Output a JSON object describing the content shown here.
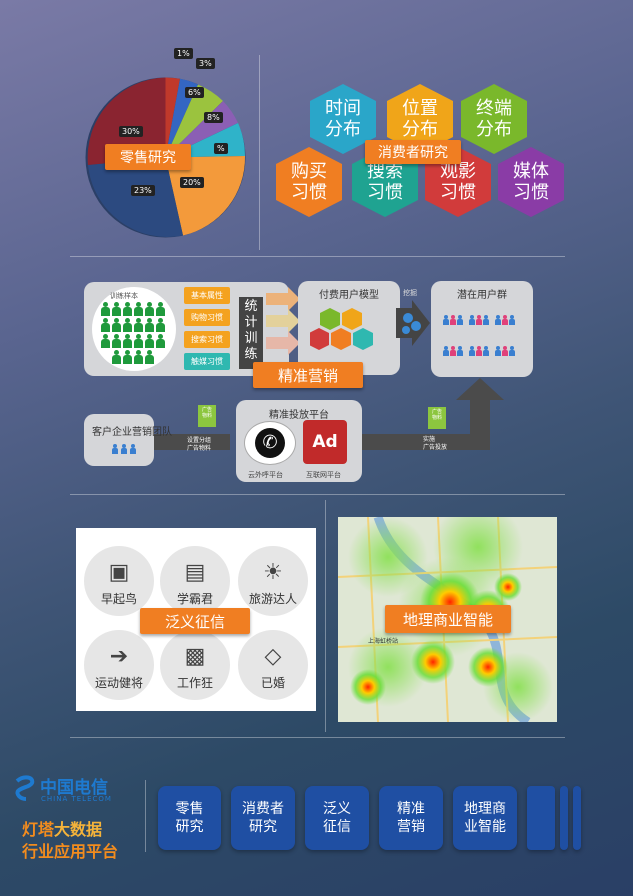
{
  "retail": {
    "label": "零售研究",
    "percents": [
      "1%",
      "3%",
      "6%",
      "8%",
      "%",
      "20%",
      "23%",
      "30%"
    ]
  },
  "consumer": {
    "label": "消费者研究",
    "hexes": [
      {
        "text": "时间\n分布",
        "color": "#2aa6c9"
      },
      {
        "text": "位置\n分布",
        "color": "#f0a519"
      },
      {
        "text": "终端\n分布",
        "color": "#7ab82b"
      },
      {
        "text": "购买\n习惯",
        "color": "#f07e22"
      },
      {
        "text": "搜索\n习惯",
        "color": "#1fa391"
      },
      {
        "text": "观影\n习惯",
        "color": "#d13b3b"
      },
      {
        "text": "媒体\n习惯",
        "color": "#8a3ca6"
      }
    ]
  },
  "precision": {
    "label": "精准营销",
    "sample_title": "训练样本",
    "attrs": [
      "基本属性",
      "购物习惯",
      "搜索习惯",
      "触媒习惯"
    ],
    "stat": "统\n计\n训\n练",
    "model_title": "付费用户模型",
    "arrow_text": "挖掘",
    "potential_title": "潜在用户群",
    "team": "客户企业营销团队",
    "ad_material_1": "广告\n物料",
    "ad_material_2": "广告\n物料",
    "note_setup": "设置分组\n广告物料",
    "platform_title": "精准投放平台",
    "cloud_label": "云外呼平台",
    "internet_label": "互联网平台",
    "ad_text": "Ad",
    "deliver_note": "实施\n广告投放"
  },
  "credit": {
    "label": "泛义征信",
    "items": [
      "早起鸟",
      "学霸君",
      "旅游达人",
      "运动健将",
      "工作狂",
      "已婚"
    ]
  },
  "geo": {
    "label": "地理商业智能",
    "map_text": "上海虹桥站"
  },
  "brand": {
    "logo_cn": "中国电信",
    "logo_en": "CHINA TELECOM",
    "line1_a": "灯塔",
    "line1_b": "大数据",
    "line2": "行业应用平台"
  },
  "nav": [
    {
      "label": "零售\n研究"
    },
    {
      "label": "消费者\n研究"
    },
    {
      "label": "泛义\n征信"
    },
    {
      "label": "精准\n营销"
    },
    {
      "label": "地理商\n业智能"
    }
  ]
}
